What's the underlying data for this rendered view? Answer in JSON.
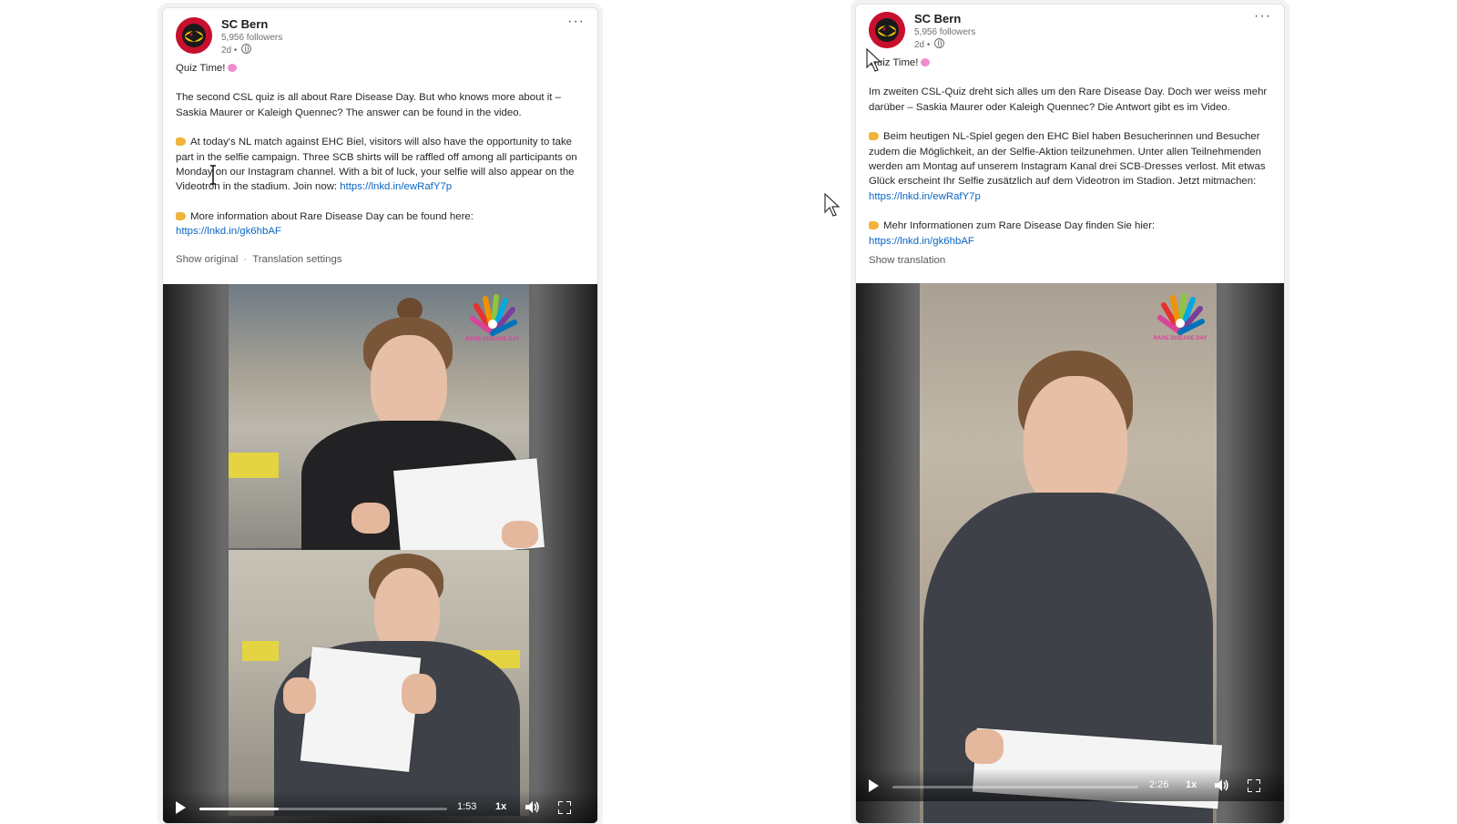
{
  "colors": {
    "link": "#0a66c2",
    "brand_red": "#c8102e",
    "brand_yellow": "#f5c400",
    "text": "#262626",
    "muted": "#707070"
  },
  "posts": [
    {
      "author": "SC Bern",
      "followers": "5,956 followers",
      "timestamp": "2d •",
      "more_icon": "···",
      "headline": "Quiz Time!",
      "paragraph_1": "The second CSL quiz is all about Rare Disease Day. But who knows more about it – Saskia Maurer or Kaleigh Quennec? The answer can be found in the video.",
      "paragraph_2": "At today's NL match against EHC Biel, visitors will also have the opportunity to take part in the selfie campaign. Three SCB shirts will be raffled off among all participants on Monday on our Instagram channel. With a bit of luck, your selfie will also appear on the Videotron in the stadium. Join now:",
      "link_1": "https://lnkd.in/ewRafY7p",
      "paragraph_3": "More information about Rare Disease Day can be found here:",
      "link_2": "https://lnkd.in/gk6hbAF",
      "show_original": "Show original",
      "translation_settings": "Translation settings",
      "video": {
        "logo_text": "RARE DISEASE DAY",
        "time": "1:53",
        "speed": "1x",
        "progress": 0.32,
        "icons": [
          "play-icon",
          "volume-icon",
          "fullscreen-icon"
        ]
      }
    },
    {
      "author": "SC Bern",
      "followers": "5,956 followers",
      "timestamp": "2d •",
      "more_icon": "···",
      "headline": "Quiz Time!",
      "paragraph_1": "Im zweiten CSL-Quiz dreht sich alles um den Rare Disease Day. Doch wer weiss mehr darüber – Saskia Maurer oder Kaleigh Quennec? Die Antwort gibt es im Video.",
      "paragraph_2": "Beim heutigen NL-Spiel gegen den EHC Biel haben Besucherinnen und Besucher zudem die Möglichkeit, an der Selfie-Aktion teilzunehmen. Unter allen Teilnehmenden werden am Montag auf unserem Instagram Kanal drei SCB-Dresses verlost. Mit etwas Glück erscheint Ihr Selfie zusätzlich auf dem Videotron im Stadion. Jetzt mitmachen:",
      "link_1": "https://lnkd.in/ewRafY7p",
      "paragraph_3": "Mehr Informationen zum Rare Disease Day finden Sie hier:",
      "link_2": "https://lnkd.in/gk6hbAF",
      "show_translation": "Show translation",
      "video": {
        "logo_text": "RARE DISEASE DAY",
        "time": "2:26",
        "speed": "1x",
        "progress": 0.0,
        "icons": [
          "play-icon",
          "volume-icon",
          "fullscreen-icon"
        ]
      }
    }
  ]
}
